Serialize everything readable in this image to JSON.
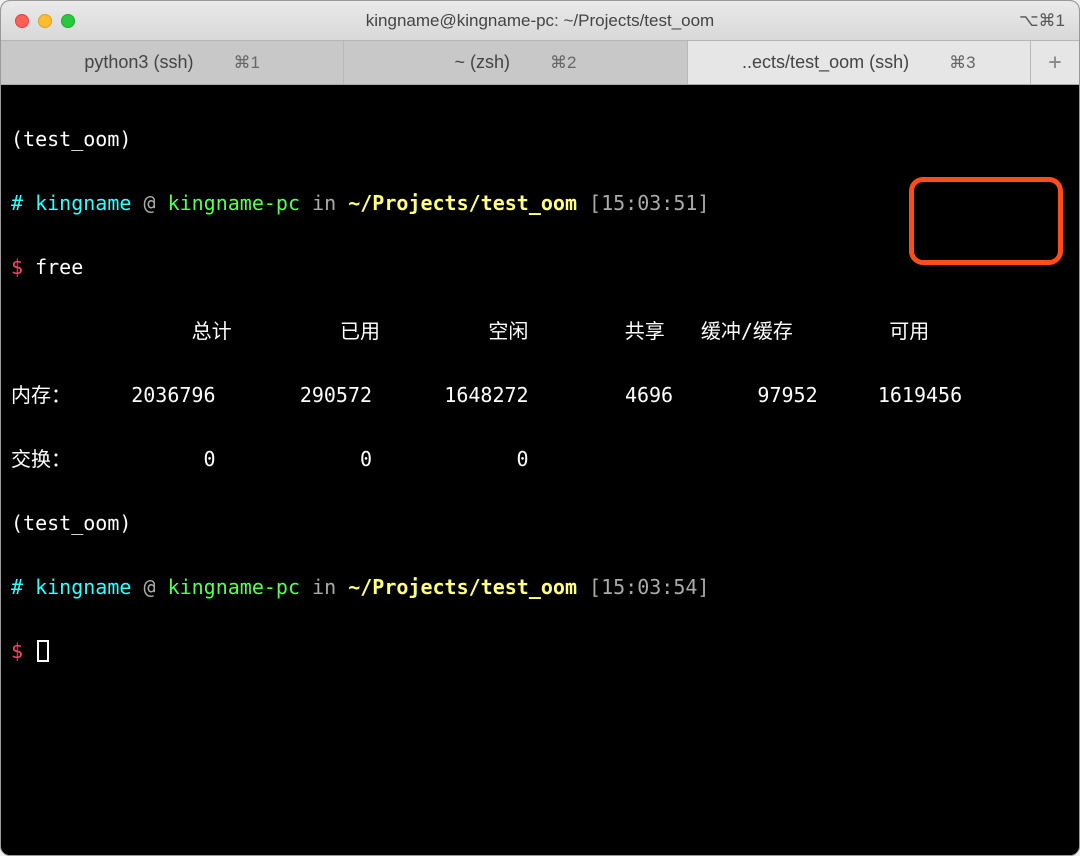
{
  "window": {
    "title": "kingname@kingname-pc: ~/Projects/test_oom",
    "right_shortcut": "⌥⌘1"
  },
  "tabs": [
    {
      "label": "python3 (ssh)",
      "shortcut": "⌘1",
      "active": false
    },
    {
      "label": "~ (zsh)",
      "shortcut": "⌘2",
      "active": false
    },
    {
      "label": "..ects/test_oom (ssh)",
      "shortcut": "⌘3",
      "active": true
    }
  ],
  "terminal": {
    "env_name": "(test_oom)",
    "prompt": {
      "hash": "#",
      "user": "kingname",
      "at": "@",
      "host": "kingname-pc",
      "in": "in",
      "path": "~/Projects/test_oom",
      "time1": "[15:03:51]",
      "time2": "[15:03:54]",
      "dollar": "$"
    },
    "command1": "free",
    "free_output": {
      "headers": [
        "总计",
        "已用",
        "空闲",
        "共享",
        "缓冲/缓存",
        "可用"
      ],
      "mem_label": "内存：",
      "mem": [
        "2036796",
        "290572",
        "1648272",
        "4696",
        "97952",
        "1619456"
      ],
      "swap_label": "交换：",
      "swap": [
        "0",
        "0",
        "0"
      ]
    }
  }
}
